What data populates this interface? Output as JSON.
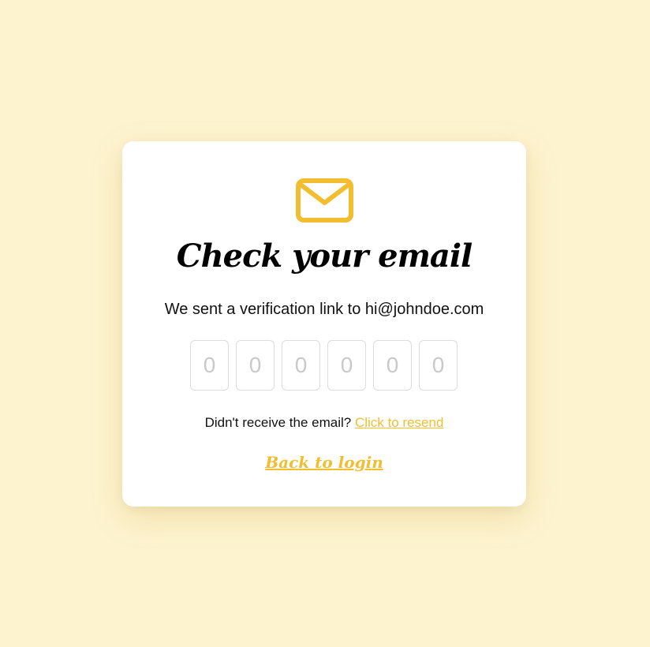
{
  "colors": {
    "background": "#fdf3cf",
    "card": "#ffffff",
    "accent": "#f2bd2e",
    "code_border": "#dcdcdc",
    "code_placeholder": "#c9c9c9"
  },
  "icon": "envelope-icon",
  "title": "Check your email",
  "subtitle": "We sent a verification link to hi@johndoe.com",
  "code_inputs": [
    {
      "placeholder": "0",
      "value": ""
    },
    {
      "placeholder": "0",
      "value": ""
    },
    {
      "placeholder": "0",
      "value": ""
    },
    {
      "placeholder": "0",
      "value": ""
    },
    {
      "placeholder": "0",
      "value": ""
    },
    {
      "placeholder": "0",
      "value": ""
    }
  ],
  "resend": {
    "prompt": "Didn't receive the email?",
    "link": "Click to resend"
  },
  "back_link": "Back to login"
}
